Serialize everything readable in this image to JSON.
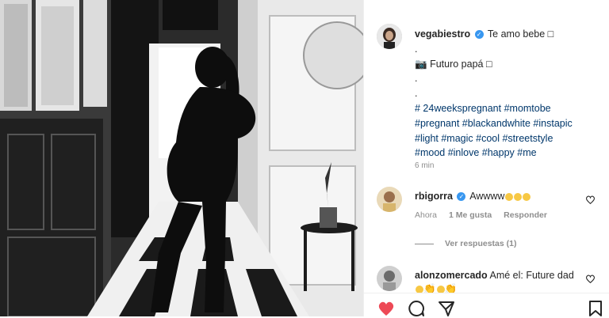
{
  "post": {
    "username": "vegabiestro",
    "caption_line1": "Te amo bebe ",
    "dot1": ".",
    "caption_line2": "Futuro papá ",
    "dot2": ".",
    "dot3": ".",
    "hashtags_line1": "# 24weekspregnant #momtobe",
    "hashtags_line2": "#pregnant #blackandwhite #instapic",
    "hashtags_line3": "#light #magic #cool #streetstyle",
    "hashtags_line4": "#mood #inlove #happy #me",
    "time": "6 min"
  },
  "comments": [
    {
      "username": "rbigorra",
      "text": "Awwww",
      "time": "Ahora",
      "likes": "1 Me gusta",
      "reply": "Responder"
    },
    {
      "username": "alonzomercado",
      "text": "Amé el:  Future dad"
    }
  ],
  "view_replies": "Ver respuestas (1)",
  "colors": {
    "like": "#ed4956",
    "verified": "#3897f0",
    "hashtag": "#00376b",
    "meta": "#8e8e8e"
  },
  "icons": [
    "verified-badge-icon",
    "camera-icon",
    "heart-outline-icon",
    "heart-filled-icon",
    "comment-icon",
    "share-icon",
    "bookmark-icon"
  ]
}
